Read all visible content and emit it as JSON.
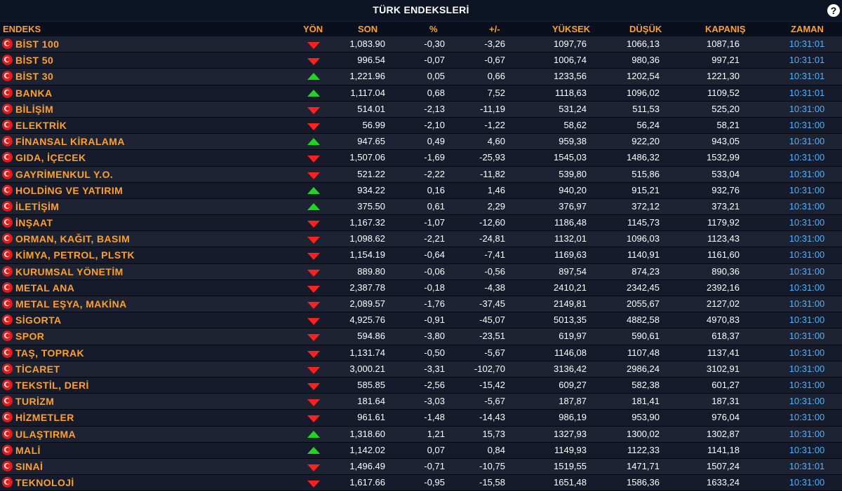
{
  "header": {
    "title": "TÜRK ENDEKSLERİ",
    "help_label": "?"
  },
  "columns": {
    "endeks": "ENDEKS",
    "yon": "YÖN",
    "son": "SON",
    "pct": "%",
    "chg": "+/-",
    "yuksek": "YÜKSEK",
    "dusuk": "DÜŞÜK",
    "kapanis": "KAPANIŞ",
    "zaman": "ZAMAN"
  },
  "colors": {
    "accent": "#ffa02a",
    "time": "#4fb3ff",
    "up": "#1fd61f",
    "down": "#ff2020",
    "background": "#0a0f1e"
  },
  "rows": [
    {
      "name": "BİST 100",
      "dir": "down",
      "son": "1,083.90",
      "pct": "-0,30",
      "chg": "-3,26",
      "high": "1097,76",
      "low": "1066,13",
      "close": "1087,16",
      "time": "10:31:01"
    },
    {
      "name": "BİST 50",
      "dir": "down",
      "son": "996.54",
      "pct": "-0,07",
      "chg": "-0,67",
      "high": "1006,74",
      "low": "980,36",
      "close": "997,21",
      "time": "10:31:01"
    },
    {
      "name": "BİST 30",
      "dir": "up",
      "son": "1,221.96",
      "pct": "0,05",
      "chg": "0,66",
      "high": "1233,56",
      "low": "1202,54",
      "close": "1221,30",
      "time": "10:31:01"
    },
    {
      "name": "BANKA",
      "dir": "up",
      "son": "1,117.04",
      "pct": "0,68",
      "chg": "7,52",
      "high": "1118,63",
      "low": "1096,02",
      "close": "1109,52",
      "time": "10:31:01"
    },
    {
      "name": "BİLİŞİM",
      "dir": "down",
      "son": "514.01",
      "pct": "-2,13",
      "chg": "-11,19",
      "high": "531,24",
      "low": "511,53",
      "close": "525,20",
      "time": "10:31:00"
    },
    {
      "name": "ELEKTRİK",
      "dir": "down",
      "son": "56.99",
      "pct": "-2,10",
      "chg": "-1,22",
      "high": "58,62",
      "low": "56,24",
      "close": "58,21",
      "time": "10:31:00"
    },
    {
      "name": "FİNANSAL KİRALAMA",
      "dir": "up",
      "son": "947.65",
      "pct": "0,49",
      "chg": "4,60",
      "high": "959,38",
      "low": "922,20",
      "close": "943,05",
      "time": "10:31:00"
    },
    {
      "name": "GIDA, İÇECEK",
      "dir": "down",
      "son": "1,507.06",
      "pct": "-1,69",
      "chg": "-25,93",
      "high": "1545,03",
      "low": "1486,32",
      "close": "1532,99",
      "time": "10:31:00"
    },
    {
      "name": "GAYRİMENKUL Y.O.",
      "dir": "down",
      "son": "521.22",
      "pct": "-2,22",
      "chg": "-11,82",
      "high": "539,80",
      "low": "515,86",
      "close": "533,04",
      "time": "10:31:00"
    },
    {
      "name": "HOLDİNG VE YATIRIM",
      "dir": "up",
      "son": "934.22",
      "pct": "0,16",
      "chg": "1,46",
      "high": "940,20",
      "low": "915,21",
      "close": "932,76",
      "time": "10:31:00"
    },
    {
      "name": "İLETİŞİM",
      "dir": "up",
      "son": "375.50",
      "pct": "0,61",
      "chg": "2,29",
      "high": "376,97",
      "low": "372,12",
      "close": "373,21",
      "time": "10:31:00"
    },
    {
      "name": "İNŞAAT",
      "dir": "down",
      "son": "1,167.32",
      "pct": "-1,07",
      "chg": "-12,60",
      "high": "1186,48",
      "low": "1145,73",
      "close": "1179,92",
      "time": "10:31:00"
    },
    {
      "name": "ORMAN, KAĞIT, BASIM",
      "dir": "down",
      "son": "1,098.62",
      "pct": "-2,21",
      "chg": "-24,81",
      "high": "1132,01",
      "low": "1096,03",
      "close": "1123,43",
      "time": "10:31:00"
    },
    {
      "name": "KİMYA, PETROL, PLSTK",
      "dir": "down",
      "son": "1,154.19",
      "pct": "-0,64",
      "chg": "-7,41",
      "high": "1169,63",
      "low": "1140,91",
      "close": "1161,60",
      "time": "10:31:00"
    },
    {
      "name": "KURUMSAL YÖNETİM",
      "dir": "down",
      "son": "889.80",
      "pct": "-0,06",
      "chg": "-0,56",
      "high": "897,54",
      "low": "874,23",
      "close": "890,36",
      "time": "10:31:00"
    },
    {
      "name": "METAL ANA",
      "dir": "down",
      "son": "2,387.78",
      "pct": "-0,18",
      "chg": "-4,38",
      "high": "2410,21",
      "low": "2342,45",
      "close": "2392,16",
      "time": "10:31:00"
    },
    {
      "name": "METAL EŞYA, MAKİNA",
      "dir": "down",
      "son": "2,089.57",
      "pct": "-1,76",
      "chg": "-37,45",
      "high": "2149,81",
      "low": "2055,67",
      "close": "2127,02",
      "time": "10:31:00"
    },
    {
      "name": "SİGORTA",
      "dir": "down",
      "son": "4,925.76",
      "pct": "-0,91",
      "chg": "-45,07",
      "high": "5013,35",
      "low": "4882,58",
      "close": "4970,83",
      "time": "10:31:00"
    },
    {
      "name": "SPOR",
      "dir": "down",
      "son": "594.86",
      "pct": "-3,80",
      "chg": "-23,51",
      "high": "619,97",
      "low": "590,61",
      "close": "618,37",
      "time": "10:31:00"
    },
    {
      "name": "TAŞ, TOPRAK",
      "dir": "down",
      "son": "1,131.74",
      "pct": "-0,50",
      "chg": "-5,67",
      "high": "1146,08",
      "low": "1107,48",
      "close": "1137,41",
      "time": "10:31:00"
    },
    {
      "name": "TİCARET",
      "dir": "down",
      "son": "3,000.21",
      "pct": "-3,31",
      "chg": "-102,70",
      "high": "3136,42",
      "low": "2986,24",
      "close": "3102,91",
      "time": "10:31:00"
    },
    {
      "name": "TEKSTİL, DERİ",
      "dir": "down",
      "son": "585.85",
      "pct": "-2,56",
      "chg": "-15,42",
      "high": "609,27",
      "low": "582,38",
      "close": "601,27",
      "time": "10:31:00"
    },
    {
      "name": "TURİZM",
      "dir": "down",
      "son": "181.64",
      "pct": "-3,03",
      "chg": "-5,67",
      "high": "187,87",
      "low": "181,41",
      "close": "187,31",
      "time": "10:31:00"
    },
    {
      "name": "HİZMETLER",
      "dir": "down",
      "son": "961.61",
      "pct": "-1,48",
      "chg": "-14,43",
      "high": "986,19",
      "low": "953,90",
      "close": "976,04",
      "time": "10:31:00"
    },
    {
      "name": "ULAŞTIRMA",
      "dir": "up",
      "son": "1,318.60",
      "pct": "1,21",
      "chg": "15,73",
      "high": "1327,93",
      "low": "1300,02",
      "close": "1302,87",
      "time": "10:31:00"
    },
    {
      "name": "MALİ",
      "dir": "up",
      "son": "1,142.02",
      "pct": "0,07",
      "chg": "0,84",
      "high": "1149,93",
      "low": "1122,33",
      "close": "1141,18",
      "time": "10:31:00"
    },
    {
      "name": "SINAİ",
      "dir": "down",
      "son": "1,496.49",
      "pct": "-0,71",
      "chg": "-10,75",
      "high": "1519,55",
      "low": "1471,71",
      "close": "1507,24",
      "time": "10:31:01"
    },
    {
      "name": "TEKNOLOJİ",
      "dir": "down",
      "son": "1,617.66",
      "pct": "-0,95",
      "chg": "-15,58",
      "high": "1651,48",
      "low": "1586,36",
      "close": "1633,24",
      "time": "10:31:00"
    }
  ]
}
